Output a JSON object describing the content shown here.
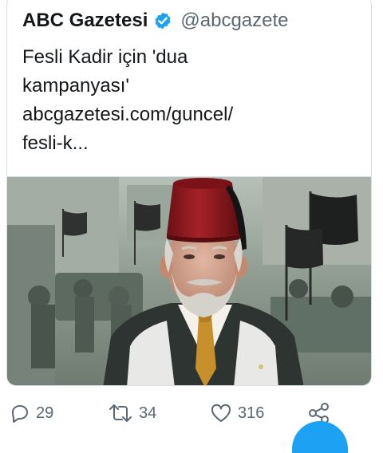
{
  "tweet": {
    "account_name": "ABC Gazetesi",
    "handle": "@abcgazete",
    "text_lines": [
      "Fesli Kadir için 'dua",
      "kampanyası'",
      "abcgazetesi.com/guncel/",
      "fesli-k..."
    ]
  },
  "media": {
    "icons": [
      "photo-man-in-fez"
    ]
  },
  "actions": {
    "reply_count": "29",
    "retweet_count": "34",
    "like_count": "316"
  },
  "colors": {
    "verified_badge": "#1da1f2",
    "fez": "#8f1a1f",
    "secondary_text": "#5b6771",
    "fab": "#1da1f2"
  }
}
